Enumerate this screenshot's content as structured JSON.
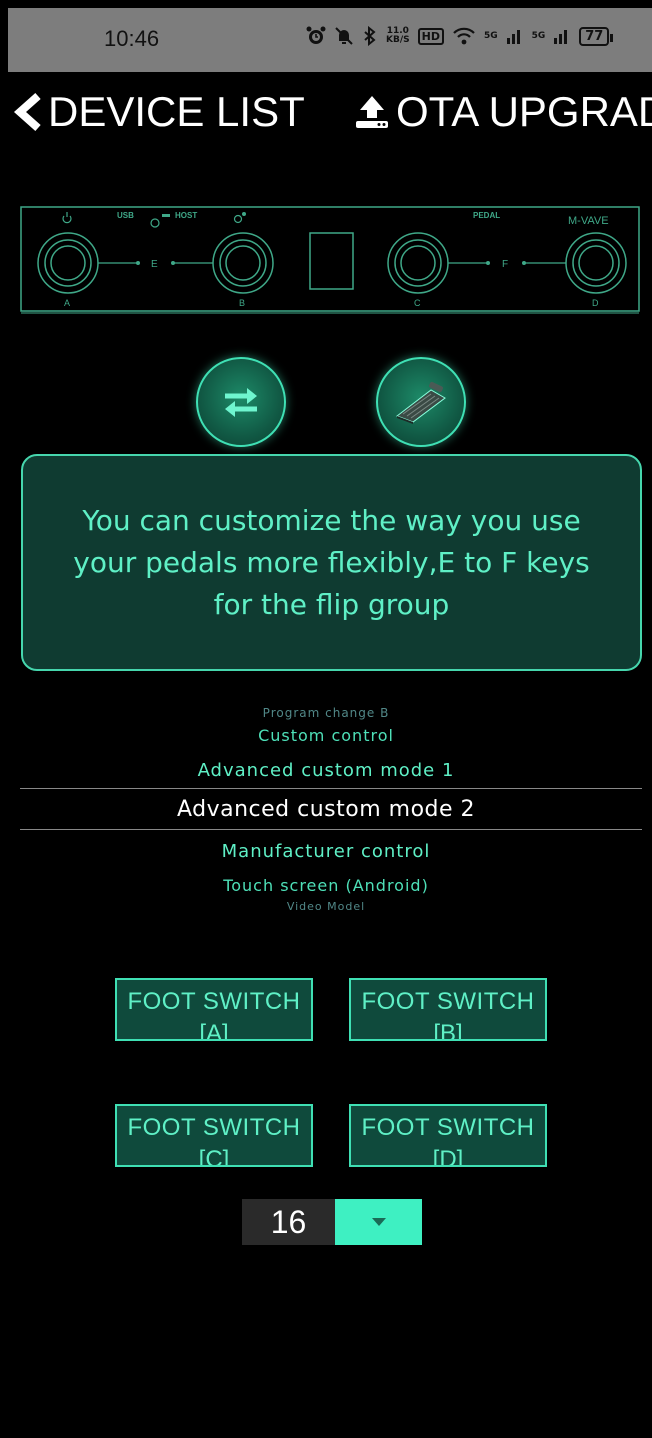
{
  "status_bar": {
    "time": "10:46",
    "net_speed_value": "11.0",
    "net_speed_unit": "KB/S",
    "hd_badge": "HD",
    "signal1": "5G",
    "signal2": "5G",
    "battery": "77"
  },
  "nav": {
    "back_label": "DEVICE LIST",
    "ota_label": "OTA UPGRAD"
  },
  "device_panel": {
    "labels": {
      "usb": "USB",
      "host": "HOST",
      "pedal": "PEDAL",
      "brand": "M-VAVE",
      "a": "A",
      "b": "B",
      "c": "C",
      "d": "D",
      "e": "E",
      "f": "F"
    }
  },
  "info_text": "You can customize the way you use your pedals more flexibly,E to F keys for the flip group",
  "mode_picker": {
    "items": [
      "Program change B",
      "Custom control",
      "Advanced custom mode 1",
      "Advanced custom mode 2",
      "Manufacturer control",
      "Touch screen (Android)",
      "Video Model"
    ],
    "selected": "Advanced custom mode 2"
  },
  "foot_switches": [
    {
      "label": "FOOT SWITCH",
      "key": "[A]"
    },
    {
      "label": "FOOT SWITCH",
      "key": "[B]"
    },
    {
      "label": "FOOT SWITCH",
      "key": "[C]"
    },
    {
      "label": "FOOT SWITCH",
      "key": "[D]"
    }
  ],
  "channel": {
    "value": "16"
  },
  "colors": {
    "accent": "#3ef0c2",
    "accent_text": "#5ff0c6",
    "panel_bg": "#0f3b31",
    "button_bg": "#0f4a3c"
  },
  "icons": {
    "back": "chevron-left-icon",
    "ota": "upload-icon",
    "swap": "swap-arrows-icon",
    "pedal": "expression-pedal-icon",
    "dropdown": "caret-down-icon"
  }
}
